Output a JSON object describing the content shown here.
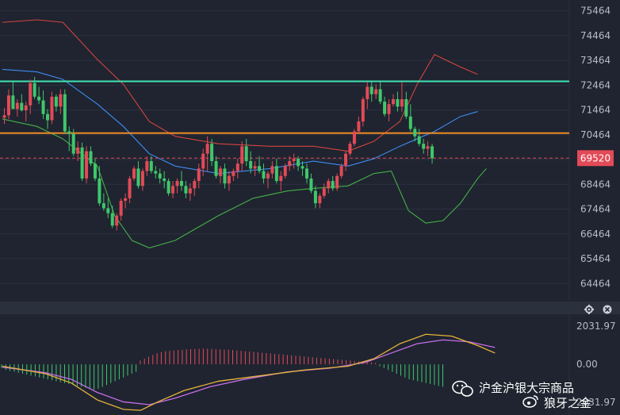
{
  "chart_data": {
    "type": "candlestick",
    "y_ticks": [
      75464,
      74464,
      73464,
      72464,
      71464,
      70464,
      69464,
      68464,
      67464,
      66464,
      65464,
      64464
    ],
    "ylim": [
      63800,
      75900
    ],
    "current_price": 69520,
    "h_lines": {
      "upper": 72620,
      "lower": 70530
    },
    "candles": [
      [
        71150,
        71550,
        70900,
        71250
      ],
      [
        71250,
        72300,
        71100,
        72050
      ],
      [
        72050,
        72600,
        71800,
        71500
      ],
      [
        71500,
        71900,
        71200,
        71750
      ],
      [
        71750,
        72100,
        71400,
        71450
      ],
      [
        71450,
        71800,
        71000,
        71650
      ],
      [
        71650,
        72700,
        71300,
        72550
      ],
      [
        72550,
        72800,
        71900,
        72000
      ],
      [
        72000,
        72400,
        71700,
        71850
      ],
      [
        71850,
        72250,
        71100,
        71300
      ],
      [
        71300,
        71500,
        70700,
        71050
      ],
      [
        71050,
        72200,
        70900,
        72000
      ],
      [
        72000,
        72100,
        71400,
        71600
      ],
      [
        71600,
        72300,
        71300,
        72100
      ],
      [
        72100,
        72300,
        70500,
        70600
      ],
      [
        70600,
        70800,
        69800,
        70500
      ],
      [
        70500,
        70700,
        69600,
        69700
      ],
      [
        69700,
        70200,
        69400,
        69950
      ],
      [
        69950,
        70150,
        68600,
        68700
      ],
      [
        68700,
        70000,
        68500,
        69800
      ],
      [
        69800,
        70000,
        69200,
        69300
      ],
      [
        69300,
        69500,
        68600,
        68700
      ],
      [
        68700,
        69200,
        67600,
        67700
      ],
      [
        67700,
        68100,
        67400,
        67500
      ],
      [
        67500,
        67900,
        67100,
        67300
      ],
      [
        67300,
        67600,
        66700,
        66800
      ],
      [
        66800,
        67300,
        66600,
        67200
      ],
      [
        67200,
        67900,
        67000,
        67800
      ],
      [
        67800,
        68100,
        67500,
        67900
      ],
      [
        67900,
        68800,
        67700,
        68700
      ],
      [
        68700,
        69200,
        68600,
        69100
      ],
      [
        69100,
        69400,
        68300,
        68400
      ],
      [
        68400,
        69100,
        68200,
        69000
      ],
      [
        69000,
        69600,
        68800,
        69400
      ],
      [
        69400,
        69600,
        68900,
        69000
      ],
      [
        69000,
        69200,
        68700,
        68900
      ],
      [
        68900,
        69100,
        68500,
        68700
      ],
      [
        68700,
        69000,
        68300,
        68600
      ],
      [
        68600,
        68700,
        68000,
        68100
      ],
      [
        68100,
        68600,
        67900,
        68400
      ],
      [
        68400,
        68700,
        68100,
        68600
      ],
      [
        68600,
        69000,
        68200,
        68400
      ],
      [
        68400,
        68600,
        67900,
        68100
      ],
      [
        68100,
        68500,
        67800,
        68300
      ],
      [
        68300,
        68700,
        68000,
        68600
      ],
      [
        68600,
        69300,
        68300,
        69100
      ],
      [
        69100,
        69900,
        68800,
        69700
      ],
      [
        69700,
        70400,
        69000,
        70100
      ],
      [
        70100,
        70300,
        69200,
        69400
      ],
      [
        69400,
        69600,
        68700,
        68800
      ],
      [
        68800,
        69200,
        68500,
        69100
      ],
      [
        69100,
        69300,
        68300,
        68500
      ],
      [
        68500,
        69000,
        68200,
        68800
      ],
      [
        68800,
        69100,
        68600,
        69000
      ],
      [
        69000,
        69500,
        68700,
        69300
      ],
      [
        69300,
        70200,
        69000,
        70000
      ],
      [
        70000,
        70300,
        69200,
        69400
      ],
      [
        69400,
        69800,
        68900,
        69100
      ],
      [
        69100,
        69400,
        68800,
        69200
      ],
      [
        69200,
        69600,
        68900,
        69000
      ],
      [
        69000,
        69300,
        68500,
        68700
      ],
      [
        68700,
        69000,
        68300,
        68900
      ],
      [
        68900,
        69400,
        68700,
        69200
      ],
      [
        69200,
        69500,
        68500,
        68600
      ],
      [
        68600,
        69000,
        68200,
        68800
      ],
      [
        68800,
        69300,
        68700,
        69200
      ],
      [
        69200,
        69600,
        69000,
        69400
      ],
      [
        69400,
        69700,
        69100,
        69500
      ],
      [
        69500,
        69600,
        69000,
        69200
      ],
      [
        69200,
        69400,
        68800,
        69100
      ],
      [
        69100,
        69300,
        68500,
        68700
      ],
      [
        68700,
        68900,
        68100,
        68200
      ],
      [
        68200,
        68400,
        67500,
        67700
      ],
      [
        67700,
        68100,
        67500,
        68000
      ],
      [
        68000,
        68500,
        67900,
        68300
      ],
      [
        68300,
        68700,
        68100,
        68600
      ],
      [
        68600,
        68800,
        68200,
        68300
      ],
      [
        68300,
        68900,
        68200,
        68800
      ],
      [
        68800,
        69300,
        68700,
        69200
      ],
      [
        69200,
        69800,
        69000,
        69700
      ],
      [
        69700,
        70200,
        69600,
        70100
      ],
      [
        70100,
        70700,
        70000,
        70600
      ],
      [
        70600,
        71200,
        70500,
        71000
      ],
      [
        71000,
        72000,
        70800,
        71900
      ],
      [
        71900,
        72600,
        71500,
        72400
      ],
      [
        72400,
        72600,
        71800,
        72100
      ],
      [
        72100,
        72500,
        71900,
        72300
      ],
      [
        72300,
        72600,
        71700,
        71800
      ],
      [
        71800,
        72000,
        71200,
        71300
      ],
      [
        71300,
        71900,
        71000,
        71700
      ],
      [
        71700,
        72100,
        71600,
        71900
      ],
      [
        71900,
        72200,
        71400,
        71600
      ],
      [
        71600,
        72600,
        71400,
        71900
      ],
      [
        71900,
        72200,
        71100,
        71200
      ],
      [
        71200,
        71700,
        70600,
        70700
      ],
      [
        70700,
        70800,
        70200,
        70400
      ],
      [
        70400,
        70700,
        70000,
        70100
      ],
      [
        70100,
        70300,
        69700,
        69900
      ],
      [
        69900,
        70200,
        69600,
        70000
      ],
      [
        70000,
        70100,
        69300,
        69520
      ]
    ],
    "bollinger": {
      "upper": [
        [
          0,
          75000
        ],
        [
          8,
          75100
        ],
        [
          14,
          75000
        ],
        [
          22,
          73500
        ],
        [
          28,
          72500
        ],
        [
          34,
          71000
        ],
        [
          40,
          70400
        ],
        [
          50,
          70100
        ],
        [
          62,
          70000
        ],
        [
          72,
          70000
        ],
        [
          80,
          69800
        ],
        [
          86,
          70200
        ],
        [
          92,
          71000
        ],
        [
          96,
          72500
        ],
        [
          100,
          73700
        ],
        [
          106,
          73200
        ],
        [
          110,
          72900
        ]
      ],
      "middle": [
        [
          0,
          73100
        ],
        [
          8,
          73000
        ],
        [
          14,
          72700
        ],
        [
          22,
          71700
        ],
        [
          28,
          70800
        ],
        [
          34,
          69700
        ],
        [
          40,
          69200
        ],
        [
          50,
          68900
        ],
        [
          62,
          69100
        ],
        [
          72,
          69400
        ],
        [
          80,
          69200
        ],
        [
          86,
          69500
        ],
        [
          92,
          70000
        ],
        [
          96,
          70300
        ],
        [
          100,
          70600
        ],
        [
          106,
          71200
        ],
        [
          110,
          71400
        ]
      ],
      "lower": [
        [
          0,
          71100
        ],
        [
          8,
          70800
        ],
        [
          14,
          70300
        ],
        [
          22,
          69200
        ],
        [
          26,
          67200
        ],
        [
          30,
          66200
        ],
        [
          34,
          65900
        ],
        [
          40,
          66200
        ],
        [
          46,
          66800
        ],
        [
          50,
          67200
        ],
        [
          58,
          67900
        ],
        [
          66,
          68200
        ],
        [
          72,
          68300
        ],
        [
          80,
          68400
        ],
        [
          86,
          68900
        ],
        [
          90,
          69000
        ],
        [
          94,
          67400
        ],
        [
          98,
          66900
        ],
        [
          102,
          67000
        ],
        [
          106,
          67700
        ],
        [
          110,
          68700
        ],
        [
          112,
          69100
        ]
      ]
    },
    "macd": {
      "y_tick_labels": [
        "2031.97",
        "0.00",
        "2031.97"
      ],
      "ylim": [
        -2700,
        2500
      ],
      "histogram": [
        -200,
        -300,
        -350,
        -400,
        -450,
        -500,
        -550,
        -600,
        -650,
        -700,
        -750,
        -800,
        -850,
        -900,
        -950,
        -1000,
        -1050,
        -1100,
        -1150,
        -1200,
        -1250,
        -1300,
        -1350,
        -1300,
        -1200,
        -1100,
        -1000,
        -900,
        -800,
        -700,
        -600,
        -500,
        -400,
        200,
        300,
        400,
        500,
        600,
        650,
        700,
        720,
        740,
        760,
        780,
        800,
        810,
        820,
        830,
        840,
        830,
        820,
        810,
        800,
        790,
        780,
        760,
        740,
        720,
        700,
        680,
        660,
        640,
        620,
        600,
        580,
        560,
        540,
        520,
        500,
        480,
        460,
        440,
        420,
        400,
        380,
        360,
        340,
        320,
        300,
        280,
        260,
        240,
        220,
        200,
        180,
        160,
        140,
        120,
        100,
        80,
        -100,
        -200,
        -300,
        -400,
        -500,
        -600,
        -700,
        -800,
        -850,
        -900,
        -950,
        -1000,
        -1050,
        -1100,
        -1150,
        -1200
      ],
      "dif": [
        [
          0,
          -100
        ],
        [
          10,
          -500
        ],
        [
          16,
          -1000
        ],
        [
          22,
          -1900
        ],
        [
          28,
          -2400
        ],
        [
          32,
          -2450
        ],
        [
          36,
          -2000
        ],
        [
          42,
          -1400
        ],
        [
          50,
          -900
        ],
        [
          60,
          -600
        ],
        [
          70,
          -300
        ],
        [
          80,
          -100
        ],
        [
          86,
          300
        ],
        [
          92,
          1100
        ],
        [
          98,
          1600
        ],
        [
          104,
          1500
        ],
        [
          110,
          1000
        ],
        [
          114,
          600
        ]
      ],
      "dea": [
        [
          0,
          -150
        ],
        [
          10,
          -450
        ],
        [
          16,
          -800
        ],
        [
          22,
          -1500
        ],
        [
          28,
          -2000
        ],
        [
          34,
          -2150
        ],
        [
          40,
          -1800
        ],
        [
          48,
          -1200
        ],
        [
          56,
          -800
        ],
        [
          66,
          -400
        ],
        [
          76,
          -200
        ],
        [
          84,
          100
        ],
        [
          90,
          600
        ],
        [
          96,
          1100
        ],
        [
          102,
          1300
        ],
        [
          108,
          1200
        ],
        [
          114,
          900
        ]
      ]
    }
  },
  "watermark": {
    "line1": "沪金沪银大宗商品",
    "line2": "狼牙之金"
  },
  "colors": {
    "background": "#1f2430",
    "up": "#e24a57",
    "down": "#3fc76b",
    "boll_upper": "#d2453f",
    "boll_middle": "#3d8cf0",
    "boll_lower": "#45b046",
    "h_line_upper": "#3fe6b3",
    "h_line_lower": "#ef8a24",
    "price_badge": "#e24a57",
    "dif": "#e6b33a",
    "dea": "#c46ee8",
    "axis_text": "#b6bcc8"
  },
  "icons": [
    "gear-icon",
    "close-icon",
    "wechat-icon",
    "weibo-icon"
  ]
}
